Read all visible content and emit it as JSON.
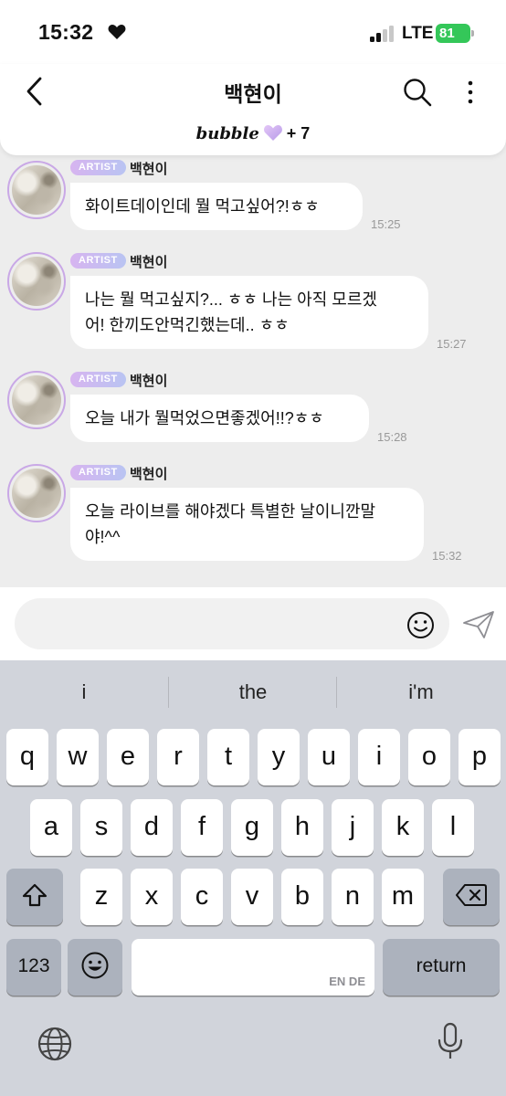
{
  "status_bar": {
    "time": "15:32",
    "network": "LTE",
    "battery": "81"
  },
  "header": {
    "title": "백현이",
    "brand": "bubble",
    "plus_count": "+ 7"
  },
  "messages": [
    {
      "badge": "ARTIST",
      "sender": "백현이",
      "text": "화이트데이인데 뭘 먹고싶어?!ㅎㅎ",
      "time": "15:25"
    },
    {
      "badge": "ARTIST",
      "sender": "백현이",
      "line1": "나는 뭘 먹고싶지?... ㅎㅎ 나는 아직 모르겠",
      "line2": "어! 한끼도안먹긴했는데.. ㅎㅎ",
      "time": "15:27"
    },
    {
      "badge": "ARTIST",
      "sender": "백현이",
      "text": "오늘 내가 뭘먹었으면좋겠어!!?ㅎㅎ",
      "time": "15:28"
    },
    {
      "badge": "ARTIST",
      "sender": "백현이",
      "line1": "오늘 라이브를 해야겠다 특별한 날이니깐말",
      "line2": "야!^^",
      "time": "15:32"
    }
  ],
  "input": {
    "placeholder": ""
  },
  "keyboard": {
    "suggestions": [
      "i",
      "the",
      "i'm"
    ],
    "row1": [
      "q",
      "w",
      "e",
      "r",
      "t",
      "y",
      "u",
      "i",
      "o",
      "p"
    ],
    "row2": [
      "a",
      "s",
      "d",
      "f",
      "g",
      "h",
      "j",
      "k",
      "l"
    ],
    "row3": [
      "z",
      "x",
      "c",
      "v",
      "b",
      "n",
      "m"
    ],
    "numbers_label": "123",
    "return_label": "return",
    "space_hint": "EN DE"
  },
  "colors": {
    "accent": "#c9a8e6",
    "battery": "#34c759",
    "chat_bg": "#ededed",
    "keyboard_bg": "#d1d4db"
  },
  "icons": [
    "heart-icon",
    "signal-icon",
    "back-icon",
    "search-icon",
    "more-icon",
    "bubble-heart-icon",
    "emoji-icon",
    "send-icon",
    "shift-icon",
    "delete-icon",
    "emoji-keyboard-icon",
    "globe-icon",
    "microphone-icon"
  ]
}
